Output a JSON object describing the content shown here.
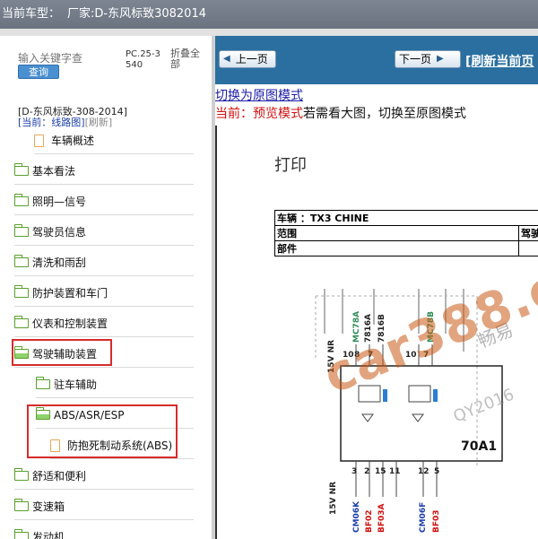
{
  "window": {
    "title_prefix": "当前车型：",
    "title_value": "厂家:D-东风标致3082014"
  },
  "sidebar": {
    "search": {
      "placeholder": "输入关键字查",
      "button_label": "查询"
    },
    "pc_code": "PC.25-3540",
    "collapse_all_label": "折叠全部",
    "model_line": "[D-东风标致-308-2014]",
    "current_label": "[当前：线路图]",
    "refresh_label": "[刷新]",
    "items": [
      {
        "label": "车辆概述",
        "type": "file",
        "level": 2
      },
      {
        "label": "基本看法",
        "type": "folder",
        "level": 1
      },
      {
        "label": "照明—信号",
        "type": "folder",
        "level": 1
      },
      {
        "label": "驾驶员信息",
        "type": "folder",
        "level": 1
      },
      {
        "label": "清洗和雨刮",
        "type": "folder",
        "level": 1
      },
      {
        "label": "防护装置和车门",
        "type": "folder",
        "level": 1
      },
      {
        "label": "仪表和控制装置",
        "type": "folder",
        "level": 1
      },
      {
        "label": "驾驶辅助装置",
        "type": "folder-open",
        "level": 1,
        "highlighted": true
      },
      {
        "label": "驻车辅助",
        "type": "folder",
        "level": 2
      },
      {
        "label": "ABS/ASR/ESP",
        "type": "folder-open",
        "level": 2,
        "highlighted": true
      },
      {
        "label": "防抱死制动系统(ABS)",
        "type": "file",
        "level": 3,
        "highlighted": true
      },
      {
        "label": "舒适和便利",
        "type": "folder",
        "level": 1
      },
      {
        "label": "变速箱",
        "type": "folder",
        "level": 1
      },
      {
        "label": "发动机",
        "type": "folder",
        "level": 1
      }
    ]
  },
  "viewer": {
    "prev_label": "上一页",
    "next_label": "下一页",
    "refresh_page_label": "[刷新当前页",
    "switch_link": "切换为原图模式",
    "mode_current_label": "当前：",
    "mode_value": "预览模式",
    "mode_hint": "若需看大图，切换至原图模式",
    "document": {
      "print_label": "打印",
      "table": {
        "vehicle_label": "车辆 ：TX3 CHINE",
        "range_label": "范围",
        "driving_label": "驾驶",
        "parts_label": "部件"
      },
      "schematic": {
        "top_voltage": "15V NR",
        "top_pins": [
          "10",
          "8",
          "7"
        ],
        "top_wires": [
          "MC78A",
          "7816A",
          "7816B",
          "MC78B"
        ],
        "top_pins_right": [
          "10",
          "7"
        ],
        "bottom_voltage": "15V NR",
        "bottom_pins": [
          "3",
          "2",
          "15",
          "11",
          "12",
          "5"
        ],
        "bottom_wires": [
          "CM06K",
          "BF02",
          "BF03A",
          "CM06F",
          "BF03"
        ],
        "component_label": "70A1"
      },
      "watermark": "car388.com",
      "watermark_cn": "畅易",
      "watermark_sub": "QY2016"
    }
  },
  "colors": {
    "nav_bar": "#2a6fa0",
    "highlight": "#d62b2b",
    "folder_green": "#5aa02c",
    "mode_red": "#d01010",
    "link_blue": "#1a1aa6"
  }
}
